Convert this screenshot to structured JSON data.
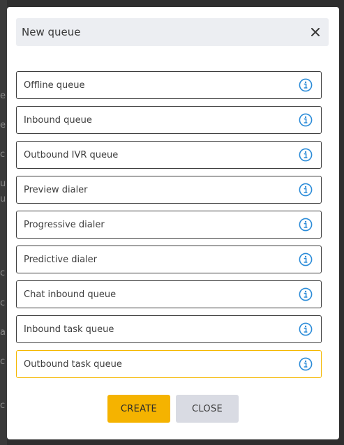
{
  "background": {
    "glyphs": [
      "e",
      "e",
      "c",
      "u",
      "u",
      "c",
      "c",
      "a",
      "c",
      "c"
    ]
  },
  "modal": {
    "title": "New queue",
    "close_icon": "close-icon",
    "options": [
      {
        "label": "Offline queue",
        "selected": false
      },
      {
        "label": "Inbound queue",
        "selected": false
      },
      {
        "label": "Outbound IVR queue",
        "selected": false
      },
      {
        "label": "Preview dialer",
        "selected": false
      },
      {
        "label": "Progressive dialer",
        "selected": false
      },
      {
        "label": "Predictive dialer",
        "selected": false
      },
      {
        "label": "Chat inbound queue",
        "selected": false
      },
      {
        "label": "Inbound task queue",
        "selected": false
      },
      {
        "label": "Outbound task queue",
        "selected": true
      }
    ],
    "info_icon": "info-circle-icon",
    "create_label": "CREATE",
    "close_label": "CLOSE"
  },
  "colors": {
    "accent": "#f5b300",
    "info": "#2a8bd8",
    "selected_border": "#f5b800",
    "secondary_button": "#d9dbe3"
  }
}
